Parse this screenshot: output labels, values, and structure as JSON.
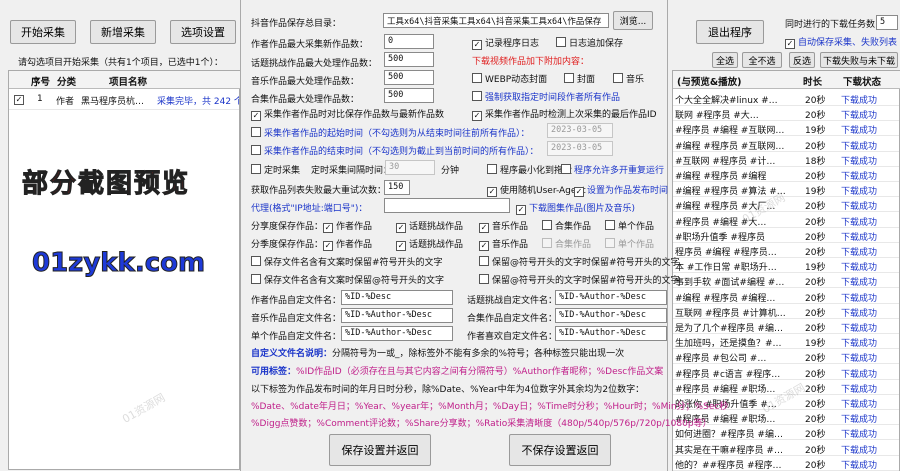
{
  "main": {
    "start_button": "开始采集",
    "add_button": "新增采集",
    "options_button": "选项设置",
    "exit_button": "退出程序",
    "status_text": "请勾选项目开始采集（共有1个项目，已选中1个）：",
    "concurrent_label": "同时进行的下载任务数",
    "concurrent_value": "5",
    "auto_save_label": "自动保存采集、失败列表",
    "select_all": "全选",
    "deselect_all": "全不选",
    "invert": "反选",
    "download_failed": "下载失败与未下载",
    "project_columns": [
      "序号",
      "分类",
      "项目名称"
    ],
    "project_row": {
      "index": "1",
      "category": "作者",
      "name": "黑马程序员杭…",
      "status": "采集完毕，共 242 个"
    },
    "overlay_text": "部分截图预览",
    "site_text": "01zykk.com",
    "watermark": "01资源网",
    "right_columns": [
      "(与预览&播放)",
      "时长",
      "下载状态"
    ],
    "right_rows": [
      {
        "title": "个大全全解决#linux #…",
        "dur": "20秒",
        "status": "下载成功"
      },
      {
        "title": "联网 #程序员 #大…",
        "dur": "20秒",
        "status": "下载成功"
      },
      {
        "title": "#程序员 #编程 #互联网…",
        "dur": "19秒",
        "status": "下载成功"
      },
      {
        "title": "#编程 #程序员 #互联网…",
        "dur": "20秒",
        "status": "下载成功"
      },
      {
        "title": "#互联网 #程序员 #计…",
        "dur": "18秒",
        "status": "下载成功"
      },
      {
        "title": "#编程 #程序员 #编程",
        "dur": "20秒",
        "status": "下载成功"
      },
      {
        "title": "#编程 #程序员 #算法 #…",
        "dur": "19秒",
        "status": "下载成功"
      },
      {
        "title": "#编程 #程序员 #大厂…",
        "dur": "20秒",
        "status": "下载成功"
      },
      {
        "title": "#程序员 #编程 #大…",
        "dur": "20秒",
        "status": "下载成功"
      },
      {
        "title": "#职场升值季 #程序员",
        "dur": "20秒",
        "status": "下载成功"
      },
      {
        "title": "程序员 #编程 #程序员…",
        "dur": "20秒",
        "status": "下载成功"
      },
      {
        "title": "本 #工作日常 #职场升…",
        "dur": "19秒",
        "status": "下载成功"
      },
      {
        "title": "事到手软 #面试#编程 #…",
        "dur": "20秒",
        "status": "下载成功"
      },
      {
        "title": "#编程 #程序员 #编程…",
        "dur": "20秒",
        "status": "下载成功"
      },
      {
        "title": "互联网 #程序员 #计算机…",
        "dur": "20秒",
        "status": "下载成功"
      },
      {
        "title": "是为了几个#程序员 #编…",
        "dur": "20秒",
        "status": "下载成功"
      },
      {
        "title": "生加班吗，还是摸鱼？#…",
        "dur": "19秒",
        "status": "下载成功"
      },
      {
        "title": "#程序员 #包公司 #…",
        "dur": "20秒",
        "status": "下载成功"
      },
      {
        "title": "#程序员 #c语言 #程序…",
        "dur": "20秒",
        "status": "下载成功"
      },
      {
        "title": "#程序员 #编程 #职场…",
        "dur": "20秒",
        "status": "下载成功"
      },
      {
        "title": "的涨你 #职场升值季 #…",
        "dur": "20秒",
        "status": "下载成功"
      },
      {
        "title": "#程序员 #编程 #职场…",
        "dur": "20秒",
        "status": "下载成功"
      },
      {
        "title": "如何进圈？#程序员 #编…",
        "dur": "20秒",
        "status": "下载成功"
      },
      {
        "title": "其实是在干嘛#程序员 #…",
        "dur": "20秒",
        "status": "下载成功"
      },
      {
        "title": "他的？##程序员 #程序…",
        "dur": "20秒",
        "status": "下载成功"
      }
    ]
  },
  "dialog": {
    "save_dir_label": "抖音作品保存总目录：",
    "save_dir_value": "工具x64\\抖音采集工具x64\\抖音采集工具x64\\作品保存",
    "browse_button": "浏览...",
    "max_author_label": "作者作品最大采集新作品数：",
    "max_author_value": "0",
    "log_record": "记录程序日志",
    "log_append": "日志追加保存",
    "topic_label": "话题挑战作品最大处理作品数：",
    "topic_value": "500",
    "download_video_note": "下载视频作品加下附加内容：",
    "music_label": "音乐作品最大处理作品数：",
    "music_value": "500",
    "webp_cover": "WEBP动态封面",
    "cover": "封面",
    "music": "音乐",
    "collection_label": "合集作品最大处理作品数：",
    "collection_value": "500",
    "force_fetch": "强制获取指定时间段作者所有作品",
    "author_compare": "采集作者作品时对比保存作品数与最新作品数",
    "author_check_last": "采集作者作品时检测上次采集的最后作品ID",
    "start_time_label": "采集作者作品的起始时间（不勾选则为从结束时间往前所有作品）：",
    "start_time_value": "2023-03-05",
    "end_time_label": "采集作者作品的结束时间（不勾选则为截止到当前时间的所有作品）：",
    "end_time_value": "2023-03-05",
    "timed_collect": "定时采集",
    "timed_interval_label": "定时采集间隔时间：",
    "timed_interval_value": "30",
    "timed_unit": "分钟",
    "minimize_tray": "程序最小化到拖盘",
    "allow_multi": "程序允许多开重复运行",
    "retry_label": "获取作品列表失败最大重试次数：",
    "retry_value": "150",
    "random_ua": "使用随机User-Agent",
    "set_time": "设置为作品发布时间",
    "proxy_label": "代理(格式\"IP地址:端口号\")：",
    "download_images": "下载图集作品(图片及音乐)",
    "type_label": "分享度保存作品：",
    "season_label": "分季度保存作品：",
    "author_works": "作者作品",
    "topic_works": "话题挑战作品",
    "music_works": "音乐作品",
    "collection_works": "合集作品",
    "single_works": "单个作品",
    "keep_hash_topic": "保存文件名含有文案时保留#符号开头的文字",
    "keep_hash_collection": "保留@符号开头的文字时保留#符号开头的文字",
    "keep_hash_title": "保存文件名含有文案时保留@符号开头的文字",
    "keep_hash_topic2": "保留@符号开头的文字时保留#符号开头的文字",
    "author_name_label": "作者作品自定文件名：",
    "author_name_value": "%ID-%Desc",
    "topic_name_label": "话题挑战自定文件名：",
    "topic_name_value": "%ID-%Author-%Desc",
    "music_name_label": "音乐作品自定文件名：",
    "music_name_value": "%ID-%Author-%Desc",
    "collection_name_label": "合集作品自定文件名：",
    "collection_name_value": "%ID-%Author-%Desc",
    "single_name_label": "单个作品自定文件名：",
    "single_name_value": "%ID-%Author-%Desc",
    "liked_name_label": "作者喜欢自定文件名：",
    "liked_name_value": "%ID-%Author-%Desc",
    "custom_note_title": "自定义文件名说明：",
    "custom_note_text": "分隔符号为一或_，除标签外不能有多余的%符号；各种标签只能出现一次",
    "tags_title": "可用标签：",
    "tags_line1": "%ID作品ID（必须存在且与其它内容之间有分隔符号）%Author作者昵称；%Desc作品文案",
    "tags_line2": "以下标签为作品发布时间的年月日时分秒，除%Date、%Year中年为4位数字外其余均为2位数字：",
    "tags_line3": "%Date、%date年月日；%Year、%year年；%Month月；%Day日；%Time时分秒；%Hour时；%Min分；%Sec秒",
    "tags_line4": "%Digg点赞数；%Comment评论数；%Share分享数；%Ratio采集清晰度（480p/540p/576p/720p/1080p等）",
    "save_button": "保存设置并返回",
    "cancel_button": "不保存设置返回"
  }
}
